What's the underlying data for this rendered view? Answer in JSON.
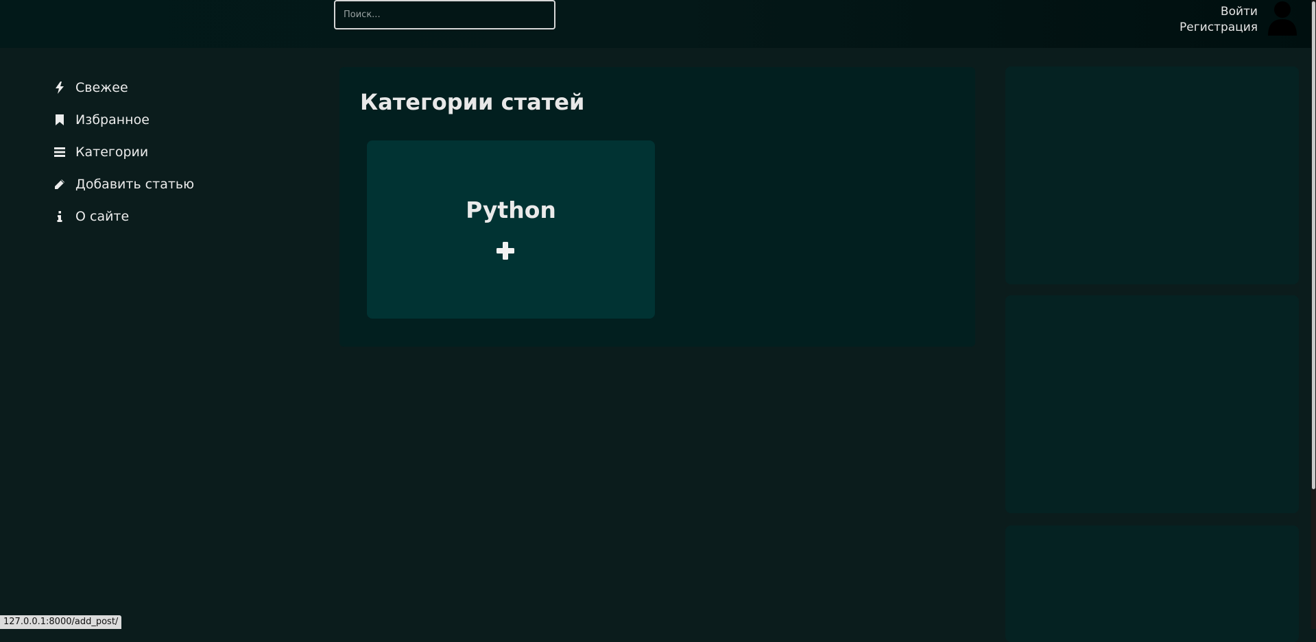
{
  "header": {
    "search_placeholder": "Поиск...",
    "login": "Войти",
    "register": "Регистрация"
  },
  "sidebar": {
    "items": [
      {
        "label": "Свежее",
        "icon": "bolt-icon"
      },
      {
        "label": "Избранное",
        "icon": "bookmark-icon"
      },
      {
        "label": "Категории",
        "icon": "list-icon"
      },
      {
        "label": "Добавить статью",
        "icon": "pencil-icon"
      },
      {
        "label": "О сайте",
        "icon": "info-icon"
      }
    ]
  },
  "main": {
    "title": "Категории статей",
    "categories": [
      {
        "name": "Python",
        "icon": "plus-icon"
      }
    ]
  },
  "status_bar": {
    "url": "127.0.0.1:8000/add_post/"
  },
  "colors": {
    "background": "#0b1c1c",
    "header": "#021919",
    "card": "#021f1f",
    "category": "#013333",
    "panel": "#052222"
  }
}
